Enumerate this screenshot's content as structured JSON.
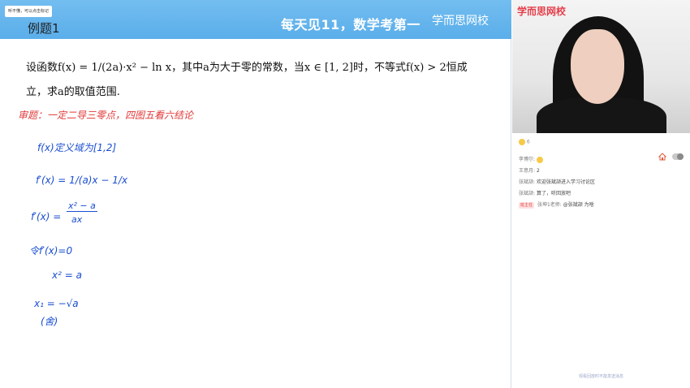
{
  "header": {
    "tip": "听不懂，可以点击标记",
    "example_title": "例题1",
    "slogan": "每天见11，数学考第一",
    "brand": "学而思网校"
  },
  "problem": {
    "line1": "设函数f(x) = 1/(2a)·x² − ln x，其中a为大于零的常数，当x ∈ [1, 2]时，不等式f(x) > 2恒成",
    "line2": "立，求a的取值范围."
  },
  "handwriting": {
    "note": "审题：一定二导三零点，四图五看六结论",
    "step1": "f(x)定义域为[1,2]",
    "step2": "f′(x) = 1/(a)x − 1/x",
    "step3_lhs": "f′(x) =",
    "step3_num": "x² − a",
    "step3_den": "ax",
    "step4": "令f′(x)=0",
    "step5": "x² = a",
    "step6": "x₁ = −√a",
    "step7": "(舍)"
  },
  "video": {
    "logo": "学而思网校"
  },
  "reactions": {
    "count": "6"
  },
  "chat": {
    "messages": [
      {
        "name": "李博尔:",
        "text": "😊"
      },
      {
        "name": "王意月:",
        "text": "2"
      },
      {
        "name": "张斌颉:",
        "text": "欢迎张斌颉进入学习讨论区"
      },
      {
        "name": "张斌颉:",
        "text": "算了，听回放吧"
      },
      {
        "badge": "班主任",
        "name": "张坤1老师:",
        "text": "@张斌颉 为啥"
      }
    ]
  },
  "footer": {
    "note": "观看回放时不能发送消息"
  },
  "colors": {
    "header_blue": "#5aaeea",
    "handwriting_red": "#e03838",
    "handwriting_blue": "#1a4ed0",
    "brand_red": "#e43e4a"
  }
}
